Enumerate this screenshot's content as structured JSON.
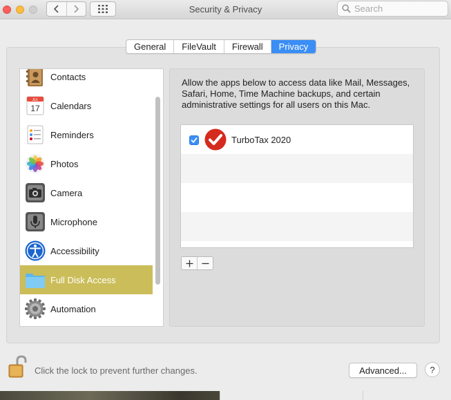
{
  "window": {
    "title": "Security & Privacy"
  },
  "search": {
    "placeholder": "Search"
  },
  "tabs": [
    {
      "label": "General"
    },
    {
      "label": "FileVault"
    },
    {
      "label": "Firewall"
    },
    {
      "label": "Privacy",
      "selected": true
    }
  ],
  "sidebar": {
    "items": [
      {
        "label": "Contacts",
        "icon": "contacts-icon"
      },
      {
        "label": "Calendars",
        "icon": "calendar-icon",
        "icon_month": "JUL",
        "icon_day": "17"
      },
      {
        "label": "Reminders",
        "icon": "reminders-icon"
      },
      {
        "label": "Photos",
        "icon": "photos-icon"
      },
      {
        "label": "Camera",
        "icon": "camera-icon"
      },
      {
        "label": "Microphone",
        "icon": "microphone-icon"
      },
      {
        "label": "Accessibility",
        "icon": "accessibility-icon"
      },
      {
        "label": "Full Disk Access",
        "icon": "folder-icon",
        "selected": true
      },
      {
        "label": "Automation",
        "icon": "gear-icon"
      }
    ]
  },
  "privacy": {
    "description": "Allow the apps below to access data like Mail, Messages, Safari, Home, Time Machine backups, and certain administrative settings for all users on this Mac.",
    "apps": [
      {
        "name": "TurboTax 2020",
        "checked": true,
        "icon": "turbotax-icon"
      }
    ],
    "add_label": "+",
    "remove_label": "−"
  },
  "footer": {
    "lock_text": "Click the lock to prevent further changes.",
    "advanced_label": "Advanced...",
    "help_label": "?"
  },
  "colors": {
    "accent": "#3b8ef5",
    "selection": "#cbbd59",
    "close": "#fc605c",
    "minimize": "#fdbc40"
  }
}
